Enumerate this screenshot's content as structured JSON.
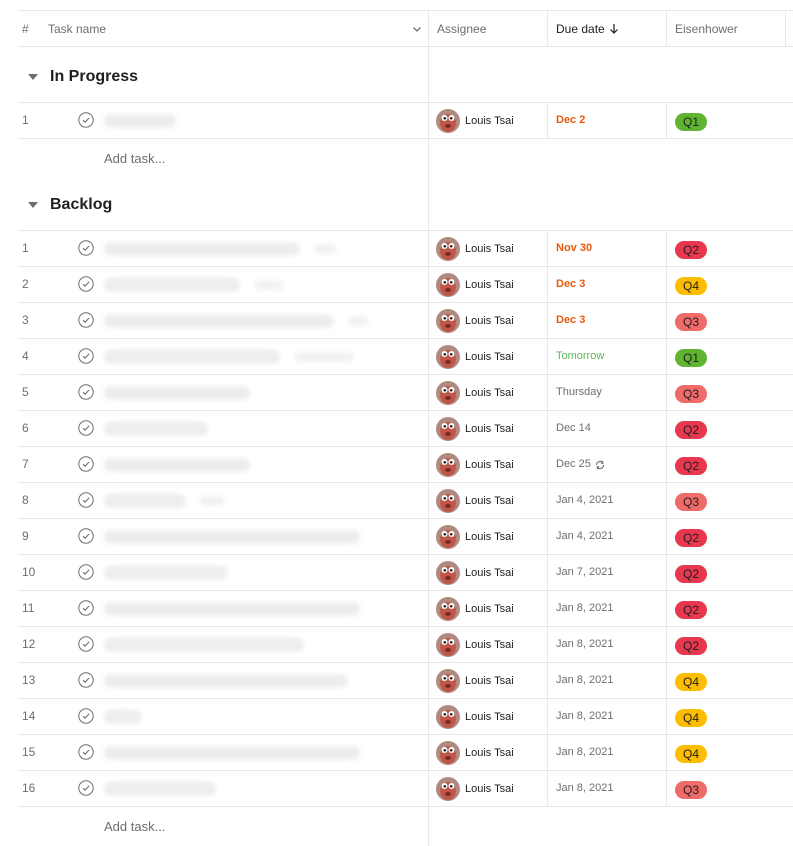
{
  "columns": {
    "num": "#",
    "task_name": "Task name",
    "assignee": "Assignee",
    "due_date": "Due date",
    "eisenhower": "Eisenhower"
  },
  "icons": {
    "task_name_menu": "chevron-down-icon",
    "sort": "arrow-down-icon",
    "check": "check-circle-icon",
    "collapse": "triangle-down-icon",
    "repeat": "repeat-icon"
  },
  "tag_colors": {
    "Q1": "#5fb532",
    "Q2": "#e8384f",
    "Q3": "#f06a6a",
    "Q4": "#fcbd01"
  },
  "sections": [
    {
      "title": "In Progress",
      "add_task": "Add task...",
      "tasks": [
        {
          "num": "1",
          "assignee": "Louis Tsai",
          "due": "Dec 2",
          "due_style": "overdue",
          "repeat": false,
          "tag": "Q1"
        }
      ]
    },
    {
      "title": "Backlog",
      "add_task": "Add task...",
      "tasks": [
        {
          "num": "1",
          "assignee": "Louis Tsai",
          "due": "Nov 30",
          "due_style": "overdue",
          "repeat": false,
          "tag": "Q2"
        },
        {
          "num": "2",
          "assignee": "Louis Tsai",
          "due": "Dec 3",
          "due_style": "overdue",
          "repeat": false,
          "tag": "Q4"
        },
        {
          "num": "3",
          "assignee": "Louis Tsai",
          "due": "Dec 3",
          "due_style": "overdue",
          "repeat": false,
          "tag": "Q3"
        },
        {
          "num": "4",
          "assignee": "Louis Tsai",
          "due": "Tomorrow",
          "due_style": "soon",
          "repeat": false,
          "tag": "Q1"
        },
        {
          "num": "5",
          "assignee": "Louis Tsai",
          "due": "Thursday",
          "due_style": "normal",
          "repeat": false,
          "tag": "Q3"
        },
        {
          "num": "6",
          "assignee": "Louis Tsai",
          "due": "Dec 14",
          "due_style": "normal",
          "repeat": false,
          "tag": "Q2"
        },
        {
          "num": "7",
          "assignee": "Louis Tsai",
          "due": "Dec 25",
          "due_style": "normal",
          "repeat": true,
          "tag": "Q2"
        },
        {
          "num": "8",
          "assignee": "Louis Tsai",
          "due": "Jan 4, 2021",
          "due_style": "normal",
          "repeat": false,
          "tag": "Q3"
        },
        {
          "num": "9",
          "assignee": "Louis Tsai",
          "due": "Jan 4, 2021",
          "due_style": "normal",
          "repeat": false,
          "tag": "Q2"
        },
        {
          "num": "10",
          "assignee": "Louis Tsai",
          "due": "Jan 7, 2021",
          "due_style": "normal",
          "repeat": false,
          "tag": "Q2"
        },
        {
          "num": "11",
          "assignee": "Louis Tsai",
          "due": "Jan 8, 2021",
          "due_style": "normal",
          "repeat": false,
          "tag": "Q2"
        },
        {
          "num": "12",
          "assignee": "Louis Tsai",
          "due": "Jan 8, 2021",
          "due_style": "normal",
          "repeat": false,
          "tag": "Q2"
        },
        {
          "num": "13",
          "assignee": "Louis Tsai",
          "due": "Jan 8, 2021",
          "due_style": "normal",
          "repeat": false,
          "tag": "Q4"
        },
        {
          "num": "14",
          "assignee": "Louis Tsai",
          "due": "Jan 8, 2021",
          "due_style": "normal",
          "repeat": false,
          "tag": "Q4"
        },
        {
          "num": "15",
          "assignee": "Louis Tsai",
          "due": "Jan 8, 2021",
          "due_style": "normal",
          "repeat": false,
          "tag": "Q4"
        },
        {
          "num": "16",
          "assignee": "Louis Tsai",
          "due": "Jan 8, 2021",
          "due_style": "normal",
          "repeat": false,
          "tag": "Q3"
        }
      ]
    }
  ]
}
